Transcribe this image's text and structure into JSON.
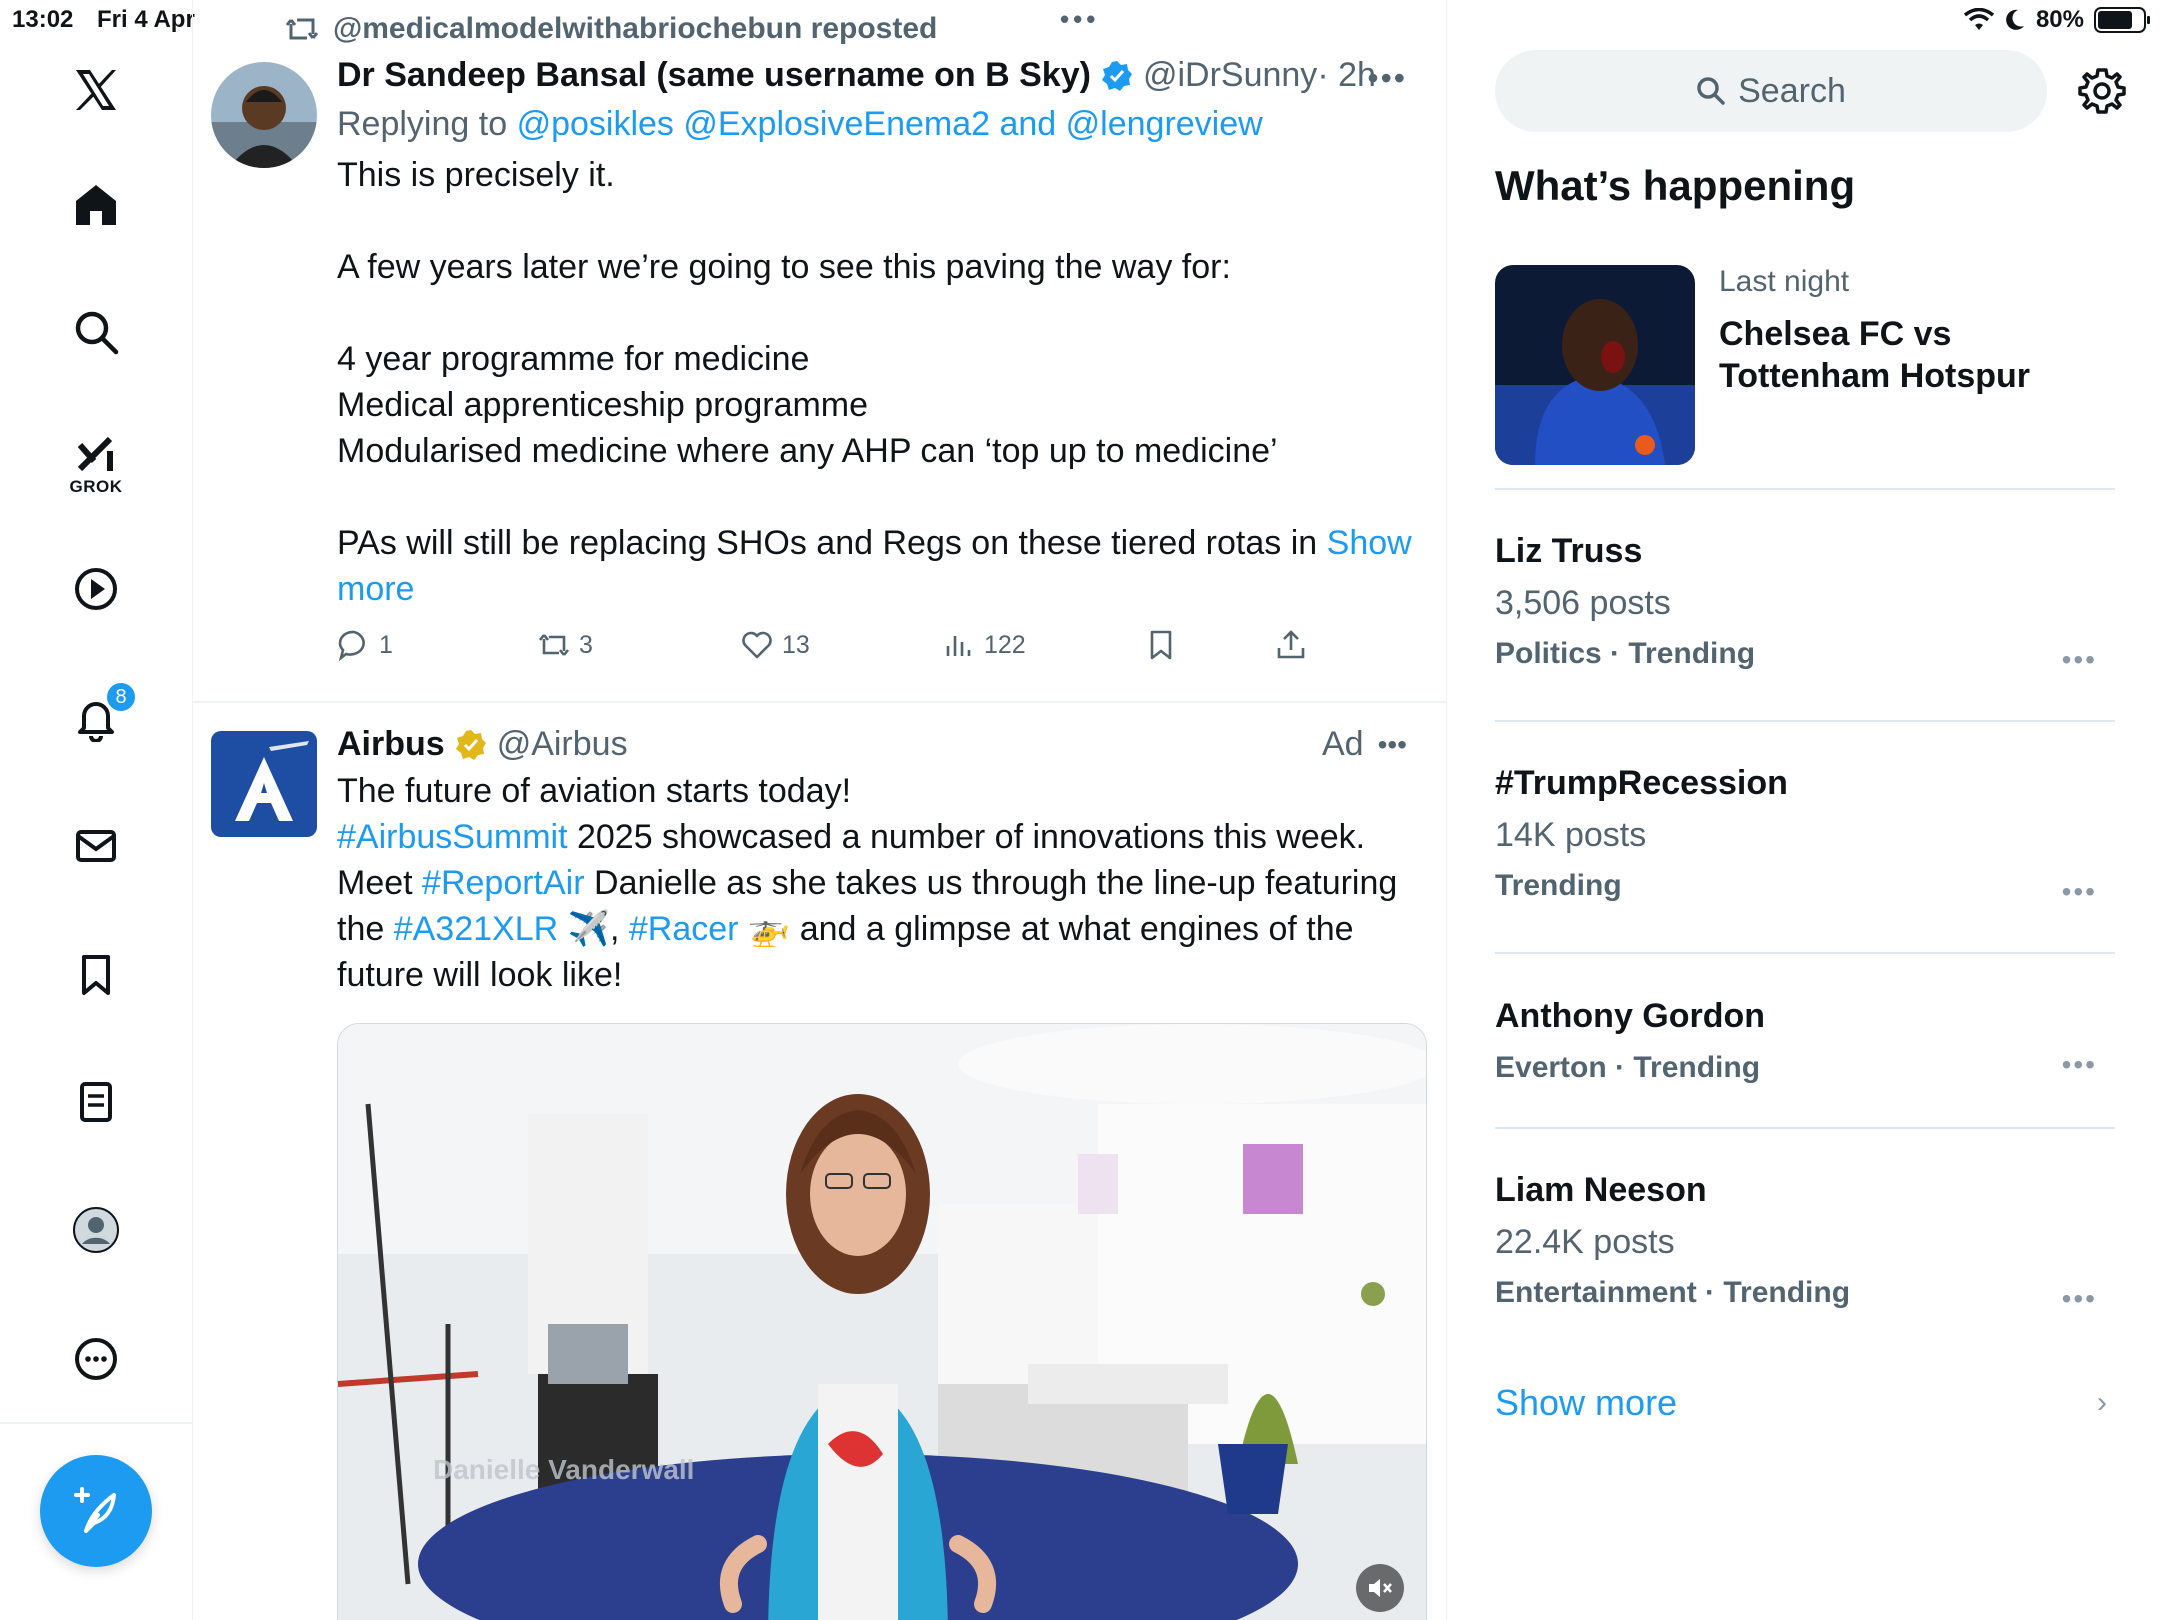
{
  "status": {
    "time": "13:02",
    "date": "Fri 4 Apr",
    "battery": "80%"
  },
  "nav": {
    "grok_label": "GROK",
    "notifications_badge": "8"
  },
  "repost": {
    "text": "@medicalmodelwithabriochebun reposted"
  },
  "tweet1": {
    "name": "Dr Sandeep Bansal (same username on B Sky)",
    "handle": "@iDrSunny",
    "time": "· 2h",
    "replying_prefix": "Replying to",
    "replying_users": "@posikles @ExplosiveEnema2 and @lengreview",
    "line1": "This is precisely it.",
    "line2": "A few years later we’re going to see this paving the way for:",
    "line3": "4 year programme for medicine",
    "line4": "Medical apprenticeship programme",
    "line5": "Modularised medicine where any AHP can ‘top up to medicine’",
    "line6": "PAs will still be replacing SHOs and Regs on these tiered rotas in",
    "show_more": "Show more",
    "replies": "1",
    "reposts": "3",
    "likes": "13",
    "views": "122"
  },
  "tweet2": {
    "name": "Airbus",
    "handle": "@Airbus",
    "ad_label": "Ad",
    "line1": "The future of aviation starts today!",
    "tag1": "#AirbusSummit",
    "text1": " 2025 showcased a number of innovations this week.",
    "text2": "Meet ",
    "tag2": "#ReportAir",
    "text3": " Danielle as she takes us through the line-up featuring",
    "text4": "the ",
    "tag3": "#A321XLR",
    "text5": " ✈️, ",
    "tag4": "#Racer",
    "text6": " 🚁 and a glimpse at what engines of the",
    "text7": "future will look like!",
    "video_caption": "Danielle Vanderwall"
  },
  "sidebar": {
    "search_placeholder": "Search",
    "section_title": "What’s happening",
    "feature": {
      "meta": "Last night",
      "title_line1": "Chelsea FC vs",
      "title_line2": "Tottenham Hotspur"
    },
    "trends": [
      {
        "title": "Liz Truss",
        "posts": "3,506 posts",
        "category": "Politics · Trending"
      },
      {
        "title": "#TrumpRecession",
        "posts": "14K posts",
        "category": "Trending"
      },
      {
        "title": "Anthony Gordon",
        "posts": "",
        "category": "Everton · Trending"
      },
      {
        "title": "Liam Neeson",
        "posts": "22.4K posts",
        "category": "Entertainment · Trending"
      }
    ],
    "show_more": "Show more"
  },
  "colors": {
    "accent": "#1d9bf0",
    "text_primary": "#0f1419",
    "text_secondary": "#536471"
  }
}
